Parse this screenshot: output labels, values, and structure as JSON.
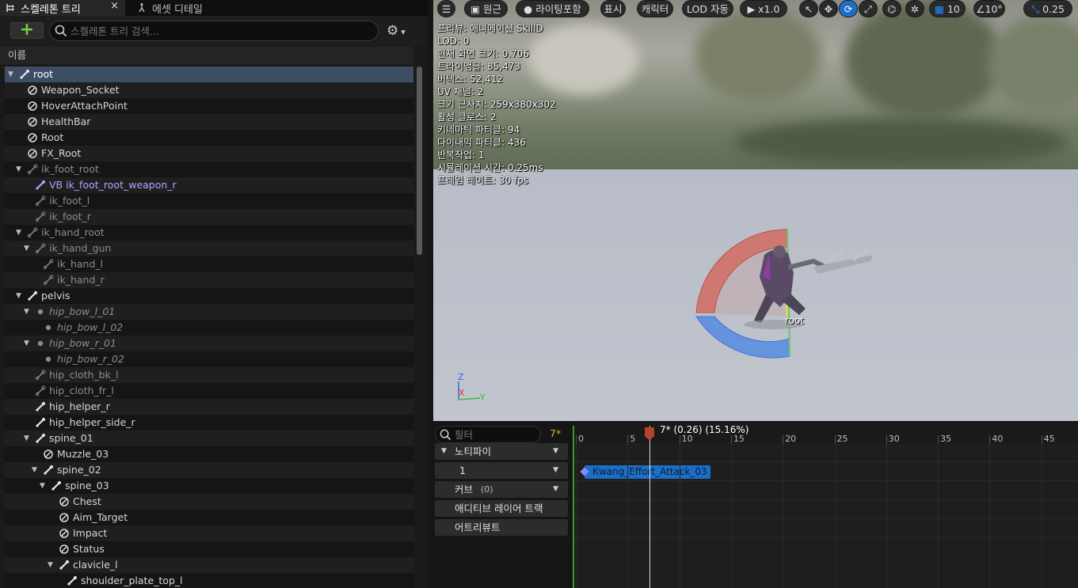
{
  "tabs": {
    "skeleton_tree": "스켈레톤 트리",
    "close": "×",
    "asset_details": "에셋 디테일"
  },
  "toolbar": {
    "add_label": "+",
    "search_placeholder": "스켈레톤 트리 검색..."
  },
  "column_header": "이름",
  "tree": [
    {
      "label": "root",
      "depth": 0,
      "icon": "bone",
      "expand": "open",
      "style": "sel"
    },
    {
      "label": "Weapon_Socket",
      "depth": 1,
      "icon": "socket",
      "style": ""
    },
    {
      "label": "HoverAttachPoint",
      "depth": 1,
      "icon": "socket",
      "style": ""
    },
    {
      "label": "HealthBar",
      "depth": 1,
      "icon": "socket",
      "style": ""
    },
    {
      "label": "Root",
      "depth": 1,
      "icon": "socket",
      "style": ""
    },
    {
      "label": "FX_Root",
      "depth": 1,
      "icon": "socket",
      "style": ""
    },
    {
      "label": "ik_foot_root",
      "depth": 1,
      "icon": "bone-dim",
      "expand": "open",
      "style": "dim"
    },
    {
      "label": "VB ik_foot_root_weapon_r",
      "depth": 2,
      "icon": "bone-vb",
      "style": "vb"
    },
    {
      "label": "ik_foot_l",
      "depth": 2,
      "icon": "bone-dim",
      "style": "dim"
    },
    {
      "label": "ik_foot_r",
      "depth": 2,
      "icon": "bone-dim",
      "style": "dim"
    },
    {
      "label": "ik_hand_root",
      "depth": 1,
      "icon": "bone-dim",
      "expand": "open",
      "style": "dim"
    },
    {
      "label": "ik_hand_gun",
      "depth": 2,
      "icon": "bone-dim",
      "expand": "open",
      "style": "dim"
    },
    {
      "label": "ik_hand_l",
      "depth": 3,
      "icon": "bone-dim",
      "style": "dim"
    },
    {
      "label": "ik_hand_r",
      "depth": 3,
      "icon": "bone-dim",
      "style": "dim"
    },
    {
      "label": "pelvis",
      "depth": 1,
      "icon": "bone",
      "expand": "open",
      "style": ""
    },
    {
      "label": "hip_bow_l_01",
      "depth": 2,
      "icon": "dot",
      "expand": "open",
      "style": "it"
    },
    {
      "label": "hip_bow_l_02",
      "depth": 3,
      "icon": "dot",
      "style": "it"
    },
    {
      "label": "hip_bow_r_01",
      "depth": 2,
      "icon": "dot",
      "expand": "open",
      "style": "it"
    },
    {
      "label": "hip_bow_r_02",
      "depth": 3,
      "icon": "dot",
      "style": "it"
    },
    {
      "label": "hip_cloth_bk_l",
      "depth": 2,
      "icon": "bone-dim",
      "style": "dim"
    },
    {
      "label": "hip_cloth_fr_l",
      "depth": 2,
      "icon": "bone-dim",
      "style": "dim"
    },
    {
      "label": "hip_helper_r",
      "depth": 2,
      "icon": "bone",
      "style": ""
    },
    {
      "label": "hip_helper_side_r",
      "depth": 2,
      "icon": "bone",
      "style": ""
    },
    {
      "label": "spine_01",
      "depth": 2,
      "icon": "bone",
      "expand": "open",
      "style": ""
    },
    {
      "label": "Muzzle_03",
      "depth": 3,
      "icon": "socket",
      "style": ""
    },
    {
      "label": "spine_02",
      "depth": 3,
      "icon": "bone",
      "expand": "open",
      "style": ""
    },
    {
      "label": "spine_03",
      "depth": 4,
      "icon": "bone",
      "expand": "open",
      "style": ""
    },
    {
      "label": "Chest",
      "depth": 5,
      "icon": "socket",
      "style": ""
    },
    {
      "label": "Aim_Target",
      "depth": 5,
      "icon": "socket",
      "style": ""
    },
    {
      "label": "Impact",
      "depth": 5,
      "icon": "socket",
      "style": ""
    },
    {
      "label": "Status",
      "depth": 5,
      "icon": "socket",
      "style": ""
    },
    {
      "label": "clavicle_l",
      "depth": 5,
      "icon": "bone",
      "expand": "open",
      "style": ""
    },
    {
      "label": "shoulder_plate_top_l",
      "depth": 6,
      "icon": "bone",
      "style": ""
    }
  ],
  "viewport": {
    "tools": {
      "menu": "☰",
      "perspective": "원근",
      "lighting": "라이팅포함",
      "show": "표시",
      "character": "캐릭터",
      "lod": "LOD 자동",
      "speed": "x1.0",
      "grid_snap": "10",
      "rot_snap": "10°",
      "scale_snap": "0.25"
    },
    "stats": [
      "프리뷰: 애니메이션 SkillD",
      "LOD: 0",
      "현재 화면 크기: 0.706",
      "트라이앵글: 85,473",
      "버텍스: 52,412",
      "UV 채널: 2",
      "크기 근사치: 259x380x302",
      "활성 클로스: 2",
      "키네마틱 파티클: 94",
      "다이내믹 파티클: 436",
      "반복작업: 1",
      "시뮬레이션 시간: 0.25ms",
      "프레임 레이트: 30 fps"
    ],
    "bone_label": "root",
    "axis_z": "Z",
    "axis_x": "X",
    "axis_y": "Y"
  },
  "timeline": {
    "filter_placeholder": "필터",
    "current_frame": "7*",
    "rows": {
      "notify": "노티파이",
      "track_1": "1",
      "curves": "커브",
      "curves_count": "(0)",
      "additive": "애디티브 레이어 트랙",
      "attributes": "어트리뷰트"
    },
    "playhead_label": "7* (0.26) (15.16%)",
    "ticks": [
      "0",
      "5",
      "10",
      "15",
      "20",
      "25",
      "30",
      "35",
      "40",
      "45"
    ],
    "notify_event": "Kwang_Effort_Attack_03"
  }
}
